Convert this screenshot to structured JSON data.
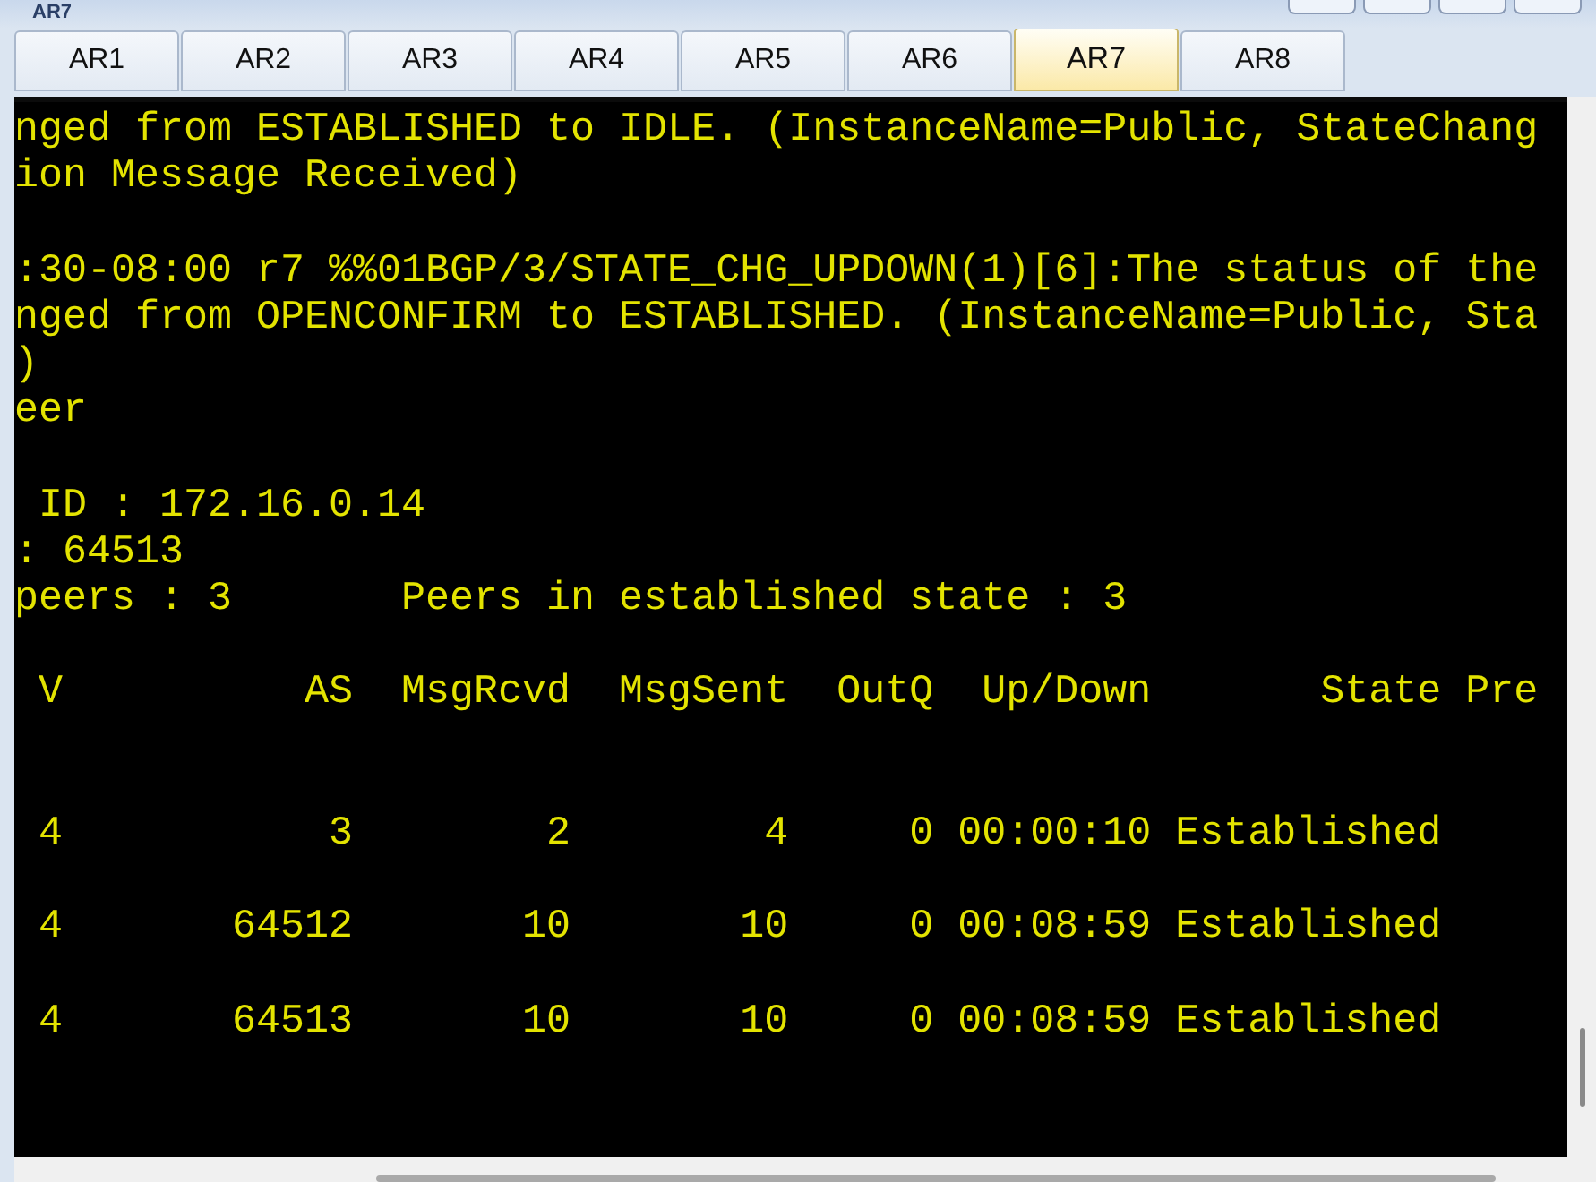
{
  "window": {
    "title": "AR7"
  },
  "tabs": [
    {
      "label": "AR1",
      "selected": false
    },
    {
      "label": "AR2",
      "selected": false
    },
    {
      "label": "AR3",
      "selected": false
    },
    {
      "label": "AR4",
      "selected": false
    },
    {
      "label": "AR5",
      "selected": false
    },
    {
      "label": "AR6",
      "selected": false
    },
    {
      "label": "AR7",
      "selected": true
    },
    {
      "label": "AR8",
      "selected": false
    }
  ],
  "terminal": {
    "lines": [
      {
        "kind": "text",
        "text": "nged from ESTABLISHED to IDLE. (InstanceName=Public, StateChang"
      },
      {
        "kind": "text",
        "text": "ion Message Received)"
      },
      {
        "kind": "blank"
      },
      {
        "kind": "text",
        "text": ":30-08:00 r7 %%01BGP/3/STATE_CHG_UPDOWN(1)[6]:The status of the"
      },
      {
        "kind": "text",
        "text": "nged from OPENCONFIRM to ESTABLISHED. (InstanceName=Public, Sta"
      },
      {
        "kind": "text",
        "text": ")"
      },
      {
        "kind": "text",
        "text": "eer"
      },
      {
        "kind": "blank"
      },
      {
        "kind": "text",
        "text": " ID : 172.16.0.14"
      },
      {
        "kind": "text",
        "text": ": 64513"
      },
      {
        "kind": "text",
        "text": "peers : 3       Peers in established state : 3"
      },
      {
        "kind": "blank"
      },
      {
        "kind": "text",
        "text": " V          AS  MsgRcvd  MsgSent  OutQ  Up/Down       State Pre"
      },
      {
        "kind": "blank"
      },
      {
        "kind": "blank"
      },
      {
        "kind": "text",
        "text": " 4           3        2        4     0 00:00:10 Established"
      },
      {
        "kind": "blank"
      },
      {
        "kind": "text",
        "text": " 4       64512       10       10     0 00:08:59 Established"
      },
      {
        "kind": "blank"
      },
      {
        "kind": "text",
        "text": " 4       64513       10       10     0 00:08:59 Established"
      }
    ]
  }
}
